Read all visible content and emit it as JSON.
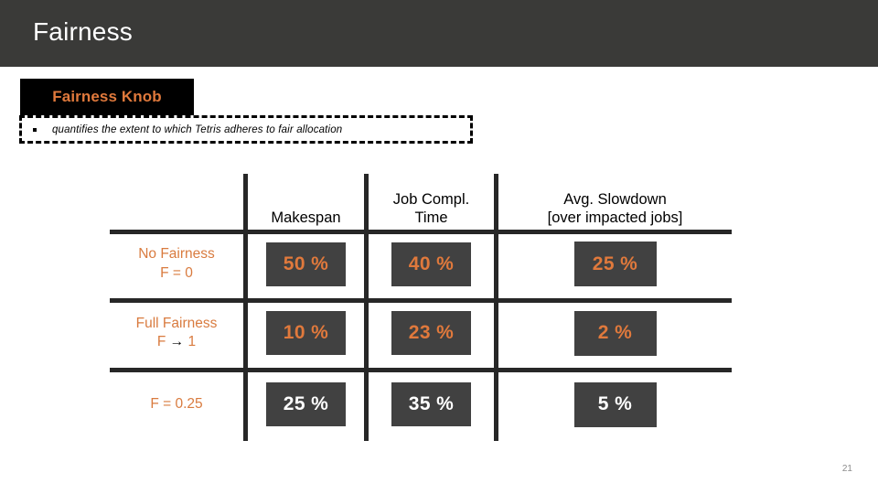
{
  "slide": {
    "title": "Fairness",
    "page_number": "21",
    "colors": {
      "header_bar": "#3a3a38",
      "accent_orange": "#e0793c",
      "badge_bg": "#414141",
      "grid_line": "#272727",
      "banner_bg": "#000000",
      "page_number": "#8c8c8c"
    }
  },
  "knob": {
    "banner_label": "Fairness Knob",
    "bullet_marker": "square-bullet-icon",
    "bullet_text": "quantifies the extent to which Tetris adheres to fair allocation"
  },
  "table": {
    "corner_header": "",
    "column_headers": [
      {
        "line1": "Makespan",
        "line2": ""
      },
      {
        "line1": "Job Compl.",
        "line2": "Time"
      },
      {
        "line1": "Avg. Slowdown",
        "line2": "[over impacted jobs]"
      }
    ],
    "rows": [
      {
        "label_line1": "No Fairness",
        "label_line2": "F = 0",
        "arrow": "",
        "label_line2_suffix": "",
        "value_style": "orange",
        "values": [
          "50 %",
          "40 %",
          "25 %"
        ]
      },
      {
        "label_line1": "Full Fairness",
        "label_line2": "F ",
        "arrow": "→",
        "label_line2_suffix": " 1",
        "value_style": "orange",
        "values": [
          "10 %",
          "23 %",
          "2 %"
        ]
      },
      {
        "label_line1": "",
        "label_line2": "F = 0.25",
        "arrow": "",
        "label_line2_suffix": "",
        "value_style": "white",
        "values": [
          "25 %",
          "35 %",
          "5 %"
        ]
      }
    ]
  }
}
